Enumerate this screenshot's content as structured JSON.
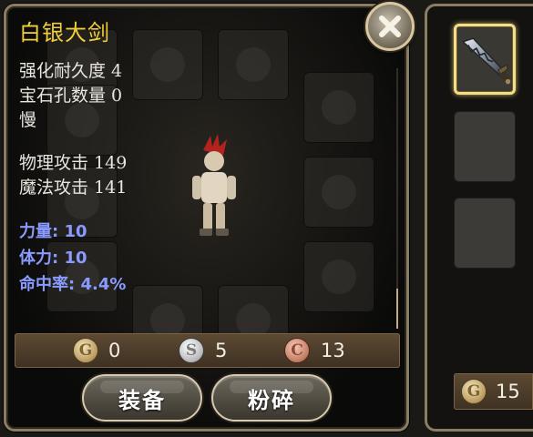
{
  "item": {
    "name": "白银大剑",
    "attributes": [
      "强化耐久度 4",
      "宝石孔数量 0",
      "慢"
    ],
    "attacks": [
      "物理攻击 149",
      "魔法攻击 141"
    ],
    "bonuses": [
      "力量: 10",
      "体力: 10",
      "命中率: 4.4%"
    ]
  },
  "currency": {
    "gold": {
      "icon": "gold-coin-icon",
      "letter": "G",
      "value": "0"
    },
    "silver": {
      "icon": "silver-coin-icon",
      "letter": "S",
      "value": "5"
    },
    "copper": {
      "icon": "copper-coin-icon",
      "letter": "C",
      "value": "13"
    }
  },
  "buttons": {
    "equip": "装备",
    "smash": "粉碎"
  },
  "side": {
    "gold_letter": "G",
    "gold_value": "15",
    "slots": [
      "sword-icon",
      "empty",
      "empty"
    ]
  },
  "colors": {
    "item_name": "#f0cf3a",
    "bonus_text": "#8a9bff",
    "selected_border": "#f4de8c"
  }
}
